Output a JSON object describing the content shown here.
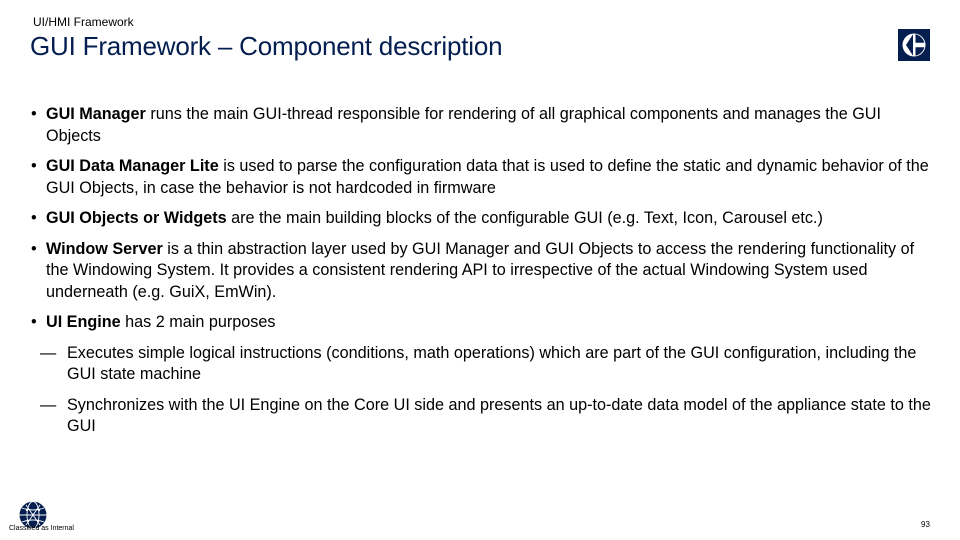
{
  "header": {
    "section_label": "UI/HMI Framework",
    "title": "GUI Framework – Component description"
  },
  "bullets": [
    {
      "bold": "GUI Manager",
      "text": " runs the main GUI-thread responsible for rendering of all graphical components and manages the GUI Objects"
    },
    {
      "bold": "GUI Data Manager Lite",
      "text": " is used to parse the configuration data that is used to define the static and dynamic behavior of the GUI Objects, in case the behavior is not hardcoded in firmware"
    },
    {
      "bold": "GUI Objects or Widgets",
      "text": " are the main building blocks of the configurable GUI (e.g. Text, Icon, Carousel etc.)"
    },
    {
      "bold": "Window Server",
      "text": " is a thin abstraction layer used by GUI Manager and GUI Objects to access the rendering functionality of the Windowing System. It provides a consistent rendering API to irrespective of the actual Windowing System used underneath (e.g. GuiX, EmWin)."
    },
    {
      "bold": "UI Engine",
      "text": " has 2 main purposes"
    }
  ],
  "sub_bullets": [
    "Executes simple logical instructions (conditions, math operations) which are part of the GUI configuration, including the GUI state machine",
    "Synchronizes with the UI Engine on the Core UI side and presents an up-to-date data model of the appliance state to the GUI"
  ],
  "bullet_char": "•",
  "dash_char": "—",
  "footer": {
    "classification": "Classified as Internal",
    "page_number": "93"
  },
  "colors": {
    "brand_navy": "#041e50",
    "text": "#000000"
  },
  "icons": {
    "brand_logo": "electrolux-logo-icon",
    "footer_logo": "globe-network-icon"
  }
}
